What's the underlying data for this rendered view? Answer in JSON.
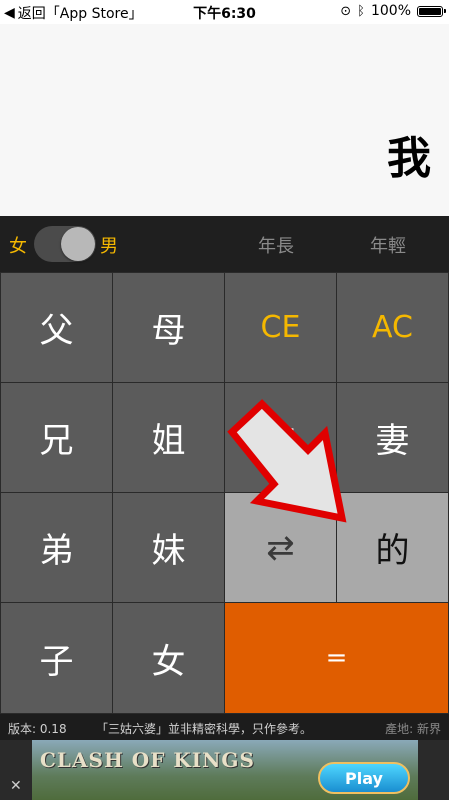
{
  "status_bar": {
    "back_label": "返回「App Store」",
    "time": "下午6:30",
    "battery": "100%",
    "battery_level": 1.0
  },
  "display": {
    "result": "我"
  },
  "options": {
    "female_label": "女",
    "male_label": "男",
    "gender_toggle_on": true,
    "older_label": "年長",
    "younger_label": "年輕"
  },
  "keys": {
    "father": "父",
    "mother": "母",
    "ce": "CE",
    "ac": "AC",
    "elder_brother": "兄",
    "elder_sister": "姐",
    "husband": "夫",
    "wife": "妻",
    "younger_brother": "弟",
    "younger_sister": "妹",
    "swap": "⇄",
    "possessive": "的",
    "son": "子",
    "daughter": "女",
    "equals": "="
  },
  "footer": {
    "version": "版本: 0.18",
    "note": "「三姑六婆」並非精密科學，只作參考。",
    "origin": "產地: 新界"
  },
  "ad": {
    "title": "CLASH OF KINGS",
    "play_label": "Play",
    "close_label": "✕"
  },
  "colors": {
    "accent": "#f5b800",
    "equals_key": "#e05d00",
    "arrow_outline": "#e00000"
  }
}
